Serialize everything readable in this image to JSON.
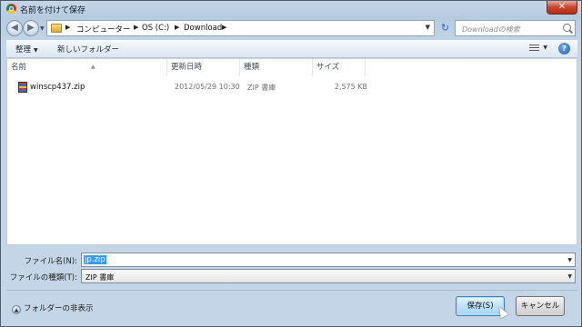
{
  "window": {
    "title": "名前を付けて保存",
    "close_label": "✕"
  },
  "address_bar": {
    "breadcrumb": [
      "コンピューター",
      "OS (C:)",
      "Download"
    ],
    "search_placeholder": "Downloadの検索"
  },
  "toolbar": {
    "organize_label": "整理",
    "new_folder_label": "新しいフォルダー",
    "help_label": "?"
  },
  "columns": {
    "name": "名前",
    "date": "更新日時",
    "type": "種類",
    "size": "サイズ"
  },
  "files": [
    {
      "name": "winscp437.zip",
      "date": "2012/05/29 10:30",
      "type": "ZIP 書庫",
      "size": "2,575 KB"
    }
  ],
  "form": {
    "filename_label": "ファイル名(N):",
    "filename_value": "jp.zip",
    "filetype_label": "ファイルの種類(T):",
    "filetype_value": "ZIP 書庫"
  },
  "footer": {
    "hide_folders_label": "フォルダーの非表示",
    "save_label": "保存(S)",
    "cancel_label": "キャンセル"
  }
}
